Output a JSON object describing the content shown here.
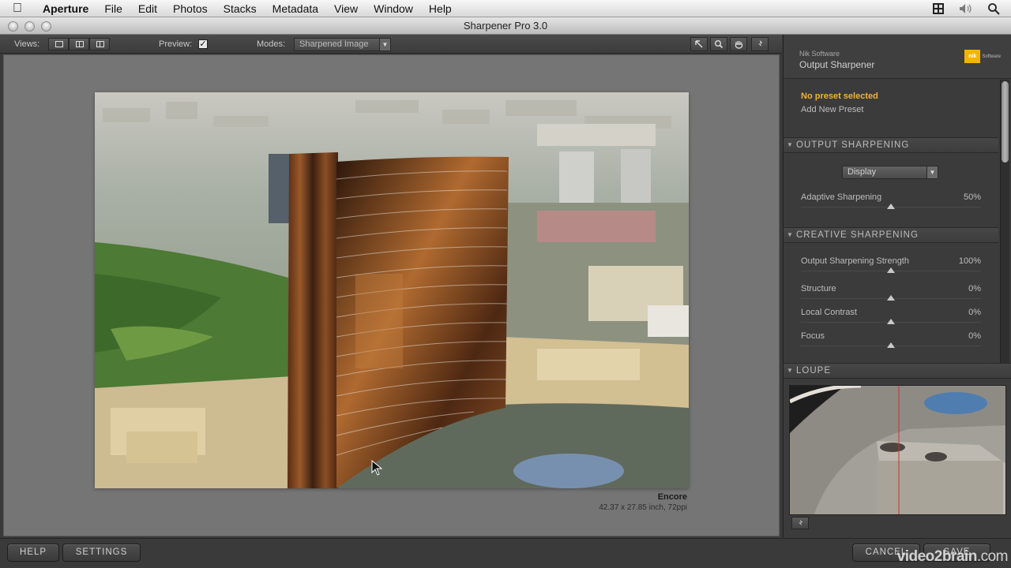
{
  "menubar": {
    "app_name": "Aperture",
    "items": [
      "File",
      "Edit",
      "Photos",
      "Stacks",
      "Metadata",
      "View",
      "Window",
      "Help"
    ]
  },
  "window": {
    "title": "Sharpener Pro 3.0"
  },
  "toolbar": {
    "views_label": "Views:",
    "preview_label": "Preview:",
    "preview_checked": "✓",
    "modes_label": "Modes:",
    "mode_value": "Sharpened Image"
  },
  "image": {
    "name": "Encore",
    "info": "42.37 x 27.85 inch, 72ppi"
  },
  "panel": {
    "vendor": "Nik Software",
    "title": "Output Sharpener",
    "logo_text": "nik",
    "logo_sub": "Software",
    "preset_current": "No preset selected",
    "preset_add": "Add New Preset",
    "sections": {
      "output": "OUTPUT SHARPENING",
      "creative": "CREATIVE SHARPENING",
      "loupe": "LOUPE"
    },
    "output_type": "Display",
    "sliders": [
      {
        "label": "Adaptive Sharpening",
        "value": "50%",
        "level": 0.5
      },
      {
        "label": "Output Sharpening Strength",
        "value": "100%",
        "level": 0.5
      },
      {
        "label": "Structure",
        "value": "0%",
        "level": 0.5
      },
      {
        "label": "Local Contrast",
        "value": "0%",
        "level": 0.5
      },
      {
        "label": "Focus",
        "value": "0%",
        "level": 0.5
      }
    ]
  },
  "buttons": {
    "help": "HELP",
    "settings": "SETTINGS",
    "cancel": "CANCEL",
    "save": "SAVE"
  },
  "watermark": {
    "brand": "video2brain",
    "domain": ".com"
  },
  "colors": {
    "preset_highlight": "#f0b42a",
    "panel_bg": "#3b3b3b",
    "canvas_bg": "#757575"
  }
}
